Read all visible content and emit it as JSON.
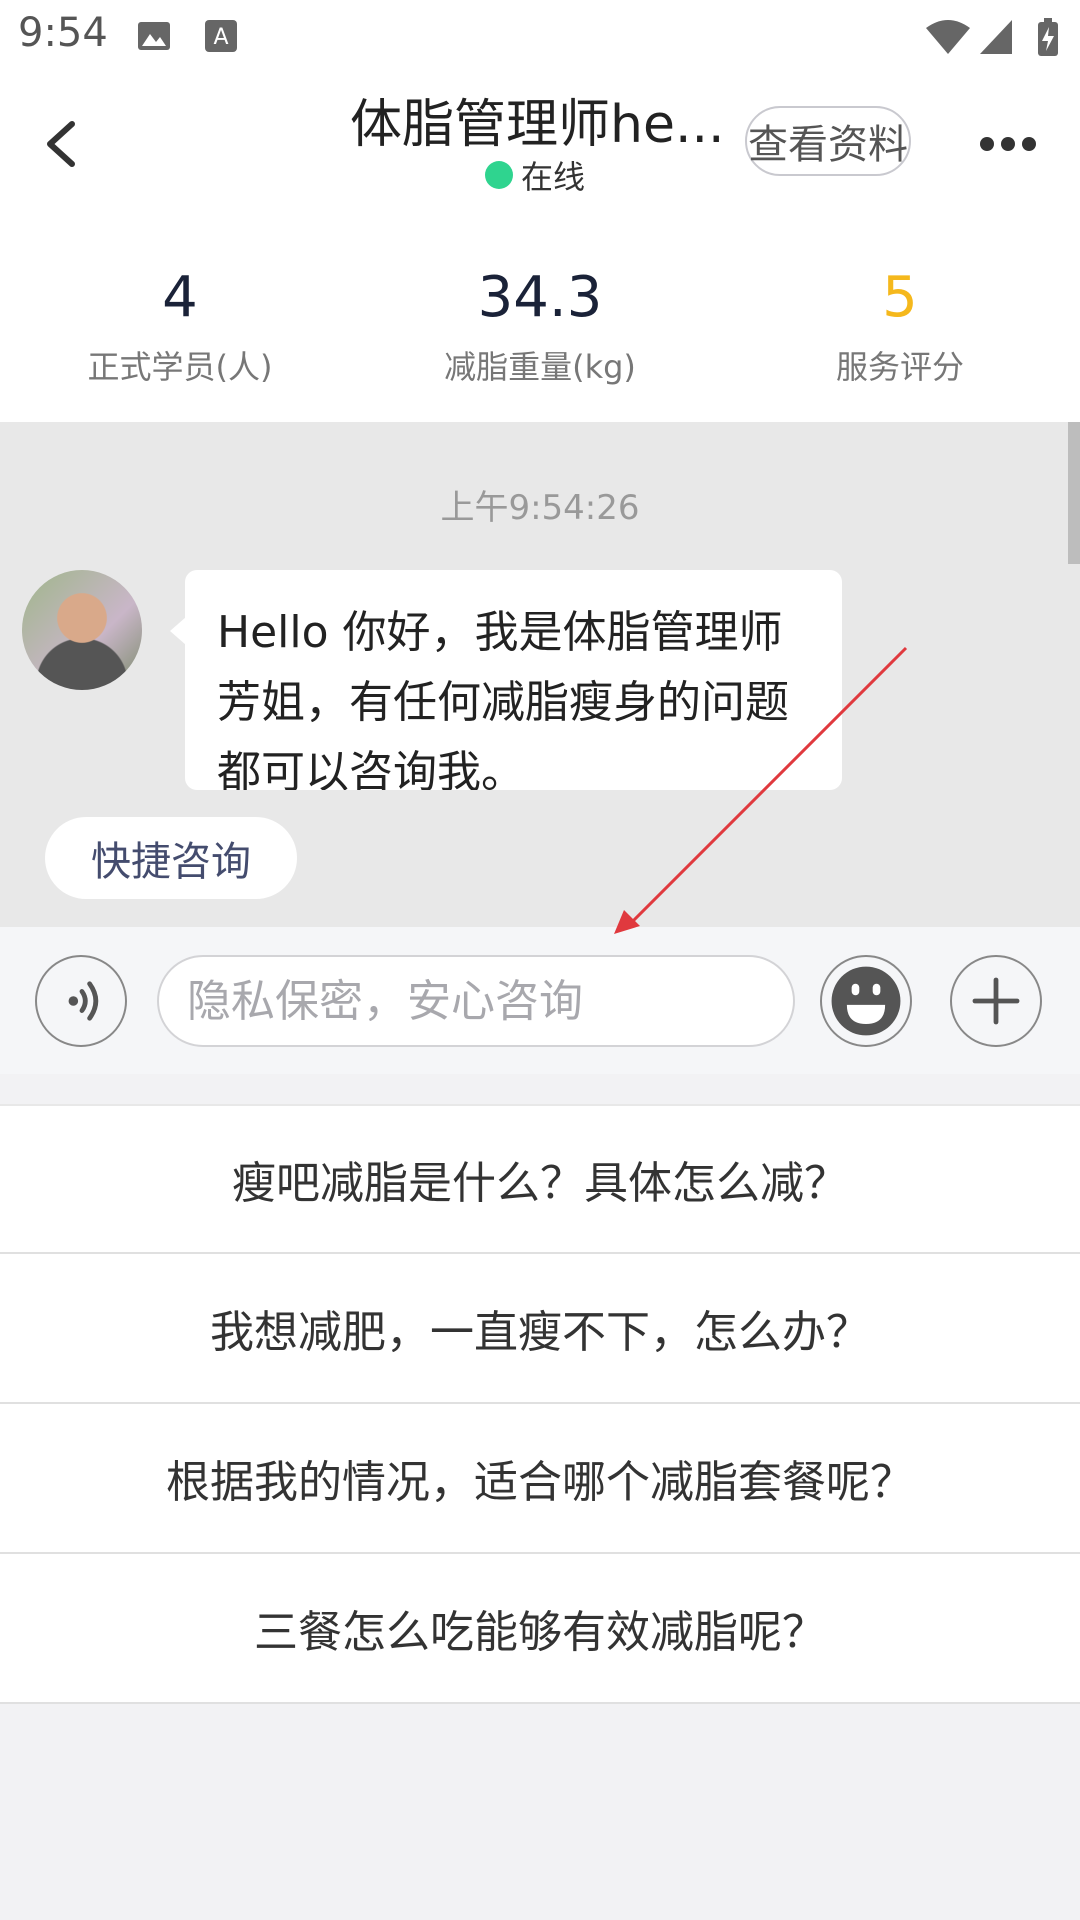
{
  "status_bar": {
    "time": "9:54"
  },
  "header": {
    "title": "体脂管理师he...",
    "online_status": "在线",
    "profile_button": "查看资料"
  },
  "stats": [
    {
      "value": "4",
      "label": "正式学员(人)",
      "color": "#1a2238"
    },
    {
      "value": "34.3",
      "label": "减脂重量(kg)",
      "color": "#1a2238"
    },
    {
      "value": "5",
      "label": "服务评分",
      "color": "#f5b81c"
    }
  ],
  "chat": {
    "timestamp": "上午9:54:26",
    "message": "Hello 你好，我是体脂管理师芳姐，有任何减脂瘦身的问题都可以咨询我。",
    "quick_consult_button": "快捷咨询"
  },
  "input_bar": {
    "placeholder": "隐私保密，安心咨询",
    "icons": [
      "voice-icon",
      "emoji-icon",
      "plus-icon"
    ]
  },
  "questions": [
    "瘦吧减脂是什么？具体怎么减？",
    "我想减肥，一直瘦不下，怎么办？",
    "根据我的情况，适合哪个减脂套餐呢？",
    "三餐怎么吃能够有效减脂呢？"
  ],
  "colors": {
    "online": "#2fd48f",
    "accent_rating": "#f5b81c",
    "annotation_arrow": "#e0393e"
  }
}
